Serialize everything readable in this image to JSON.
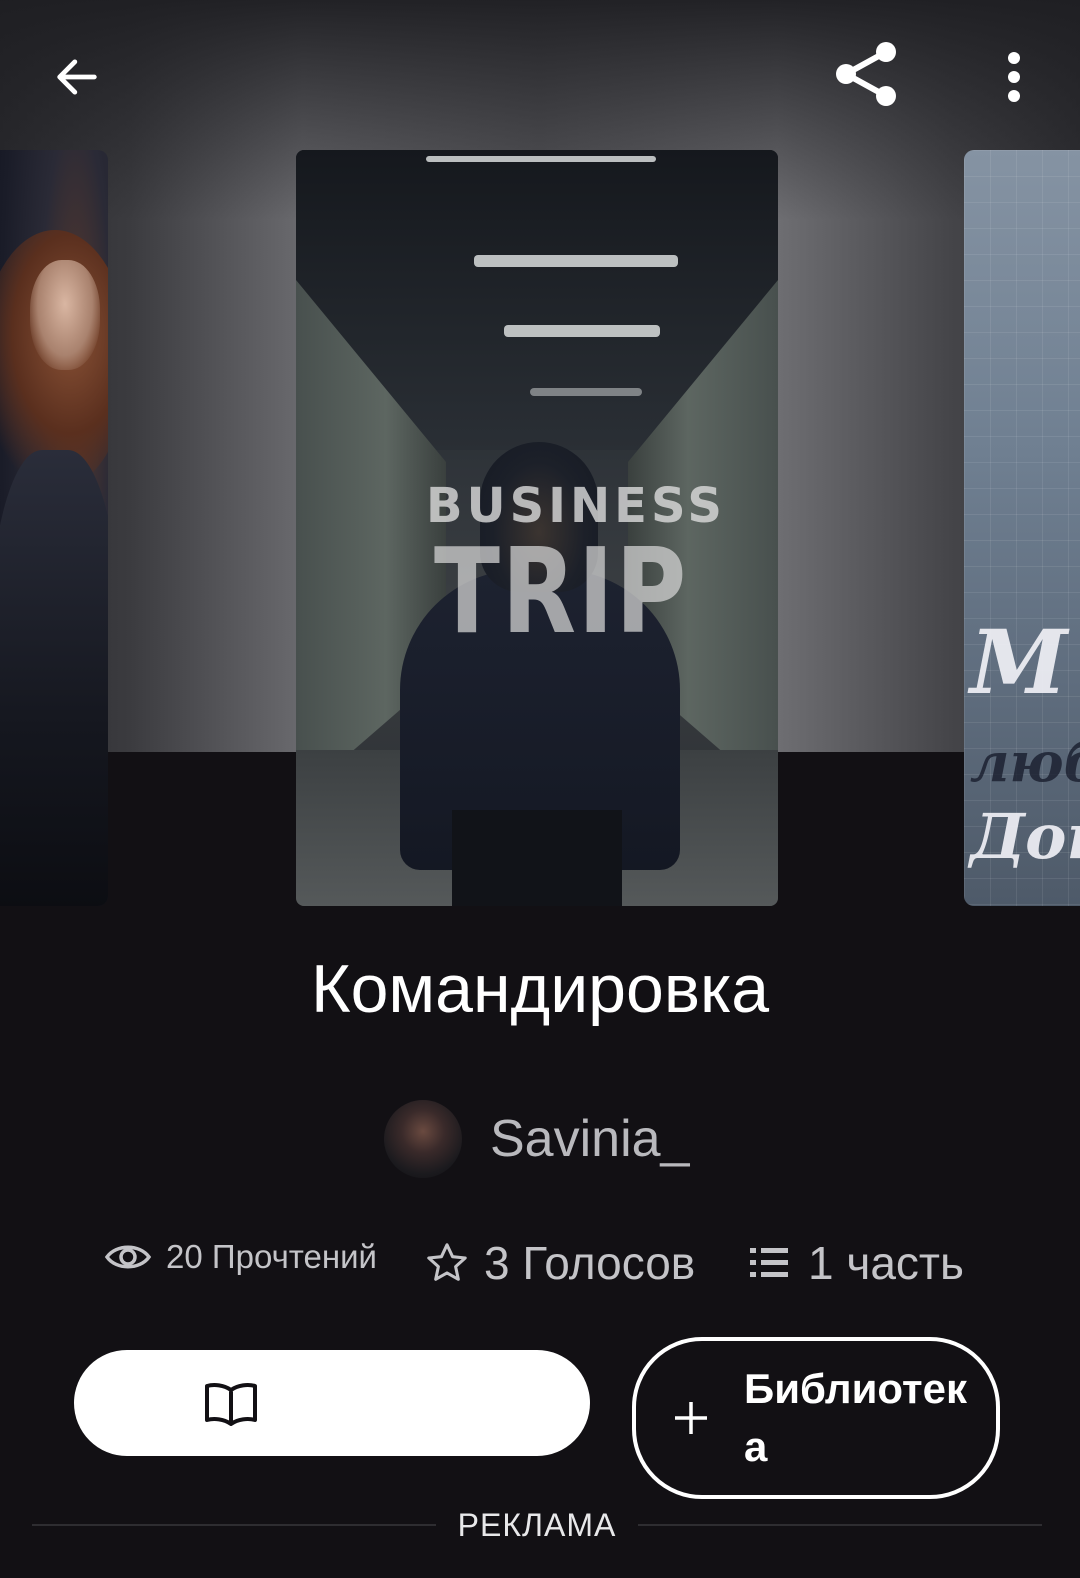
{
  "header": {
    "back_icon": "arrow-left-icon",
    "share_icon": "share-icon",
    "more_icon": "more-vertical-icon"
  },
  "covers": {
    "main": {
      "title_line1": "BUSINESS",
      "title_line2": "TRIP"
    },
    "right_partial": {
      "line1": "M",
      "line2": "любі",
      "line3": "Док"
    }
  },
  "story": {
    "title": "Командировка",
    "author": "Savinia_"
  },
  "stats": {
    "reads": "20 Прочтений",
    "votes": "3 Голосов",
    "parts": "1 часть"
  },
  "actions": {
    "read_icon": "open-book-icon",
    "library_label": "Библиотека",
    "library_icon": "plus-icon"
  },
  "ad": {
    "label": "РЕКЛАМА"
  },
  "colors": {
    "background": "#121014",
    "text_primary": "#ffffff",
    "text_secondary": "#c4c4c8"
  }
}
